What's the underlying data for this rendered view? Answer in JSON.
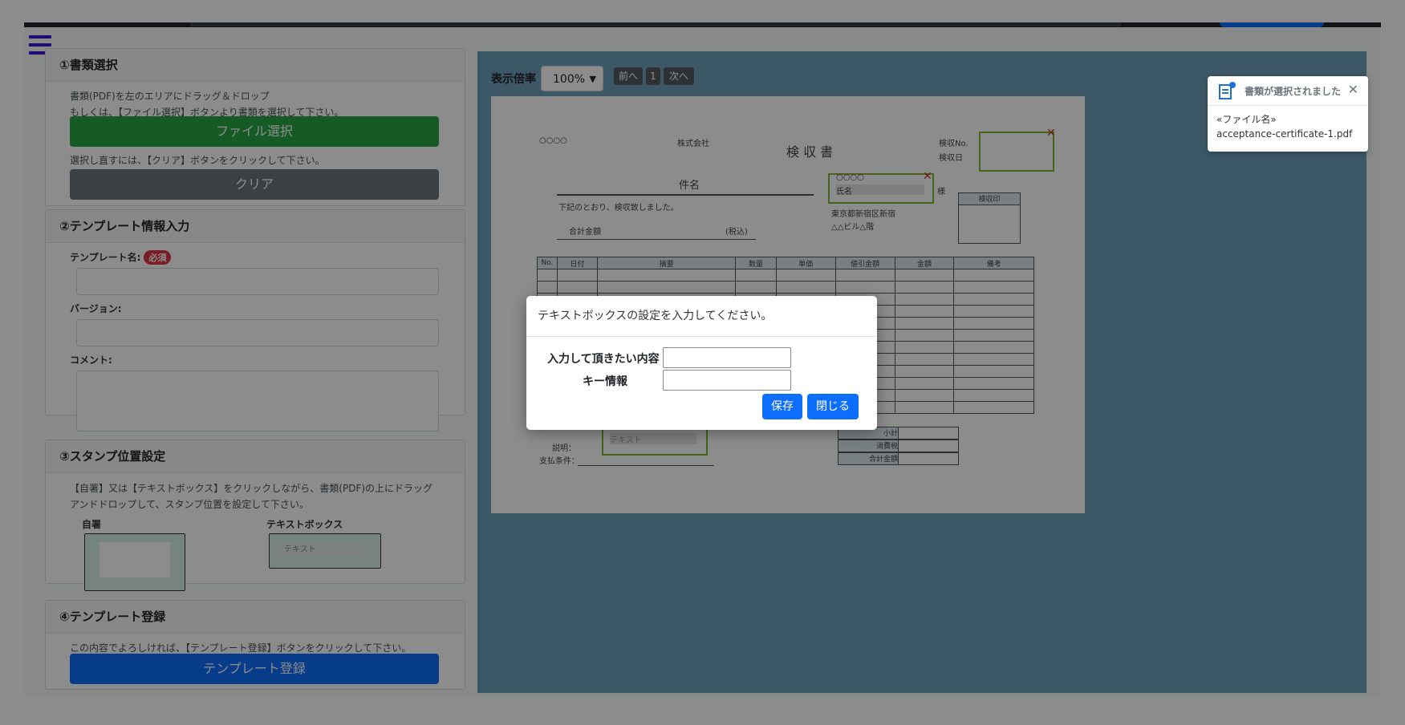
{
  "sidebar": {
    "section1": {
      "title": "①書類選択",
      "hint1": "書類(PDF)を左のエリアにドラッグ＆ドロップ",
      "hint2": "もしくは、【ファイル選択】ボタンより書類を選択して下さい。",
      "file_button": "ファイル選択",
      "hint3": "選択し直すには、【クリア】ボタンをクリックして下さい。",
      "clear_button": "クリア"
    },
    "section2": {
      "title": "②テンプレート情報入力",
      "name_label": "テンプレート名:",
      "required": "必須",
      "version_label": "バージョン:",
      "comment_label": "コメント:"
    },
    "section3": {
      "title": "③スタンプ位置設定",
      "hint": "【自署】又は【テキストボックス】をクリックしながら、書類(PDF)の上にドラッグアンドドロップして、スタンプ位置を設定して下さい。",
      "sign_label": "自署",
      "textbox_label": "テキストボックス",
      "textbox_text": "テキスト"
    },
    "section4": {
      "title": "④テンプレート登録",
      "hint": "この内容でよろしければ、【テンプレート登録】ボタンをクリックして下さい。",
      "register_button": "テンプレート登録"
    }
  },
  "viewer": {
    "zoom_label": "表示倍率",
    "zoom_value": "100%",
    "prev": "前へ",
    "page": "1",
    "next": "次へ"
  },
  "document": {
    "circles": "○○○○",
    "company": "株式会社",
    "title": "検 収 書",
    "inspection_no": "検収No.",
    "inspection_date": "検収日",
    "subject": "件名",
    "sentence": "下記のとおり、検収致しました。",
    "total_label": "合計金額",
    "tax": "(税込)",
    "dots": "○○○○",
    "name_field": "氏名",
    "sama": "様",
    "address1": "東京都新宿区新宿",
    "address2": "△△ビル△階",
    "stamp_label": "検収印",
    "columns": [
      "No.",
      "日付",
      "摘要",
      "数量",
      "単価",
      "値引金額",
      "金額",
      "備考"
    ],
    "subtotal": "小計",
    "consumption_tax": "消費税",
    "grand_total": "合計金額",
    "notes": "説明：",
    "payment_terms": "支払条件：",
    "textbox_stamp": "テキスト"
  },
  "toast": {
    "title": "書類が選択されました",
    "close": "✕",
    "file_label": "«ファイル名»",
    "file_name": "acceptance-certificate-1.pdf"
  },
  "modal": {
    "title": "テキストボックスの設定を入力してください。",
    "content_label": "入力して頂きたい内容",
    "key_label": "キー情報",
    "save_button": "保存",
    "close_button": "閉じる"
  }
}
